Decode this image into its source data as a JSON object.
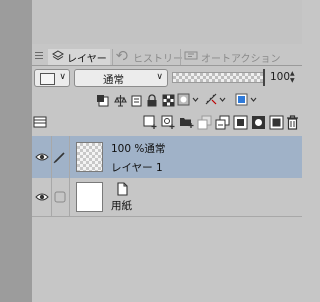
{
  "tabs": [
    {
      "label": "レイヤー",
      "icon": "layers-icon",
      "active": true
    },
    {
      "label": "ヒストリー",
      "icon": "history-icon",
      "active": false
    },
    {
      "label": "オートアクション",
      "icon": "auto-action-icon",
      "active": false
    }
  ],
  "blend_mode": {
    "value": "通常"
  },
  "opacity": {
    "value": "100",
    "fraction": 1.0
  },
  "layers": [
    {
      "mode_line": "100 %通常",
      "name": "レイヤー 1",
      "selected": true
    },
    {
      "name": "用紙",
      "selected": false
    }
  ],
  "colors": {
    "selection": "#a0b2c8",
    "panel": "#c6c6c6",
    "accent_blue": "#2f7ad9"
  }
}
